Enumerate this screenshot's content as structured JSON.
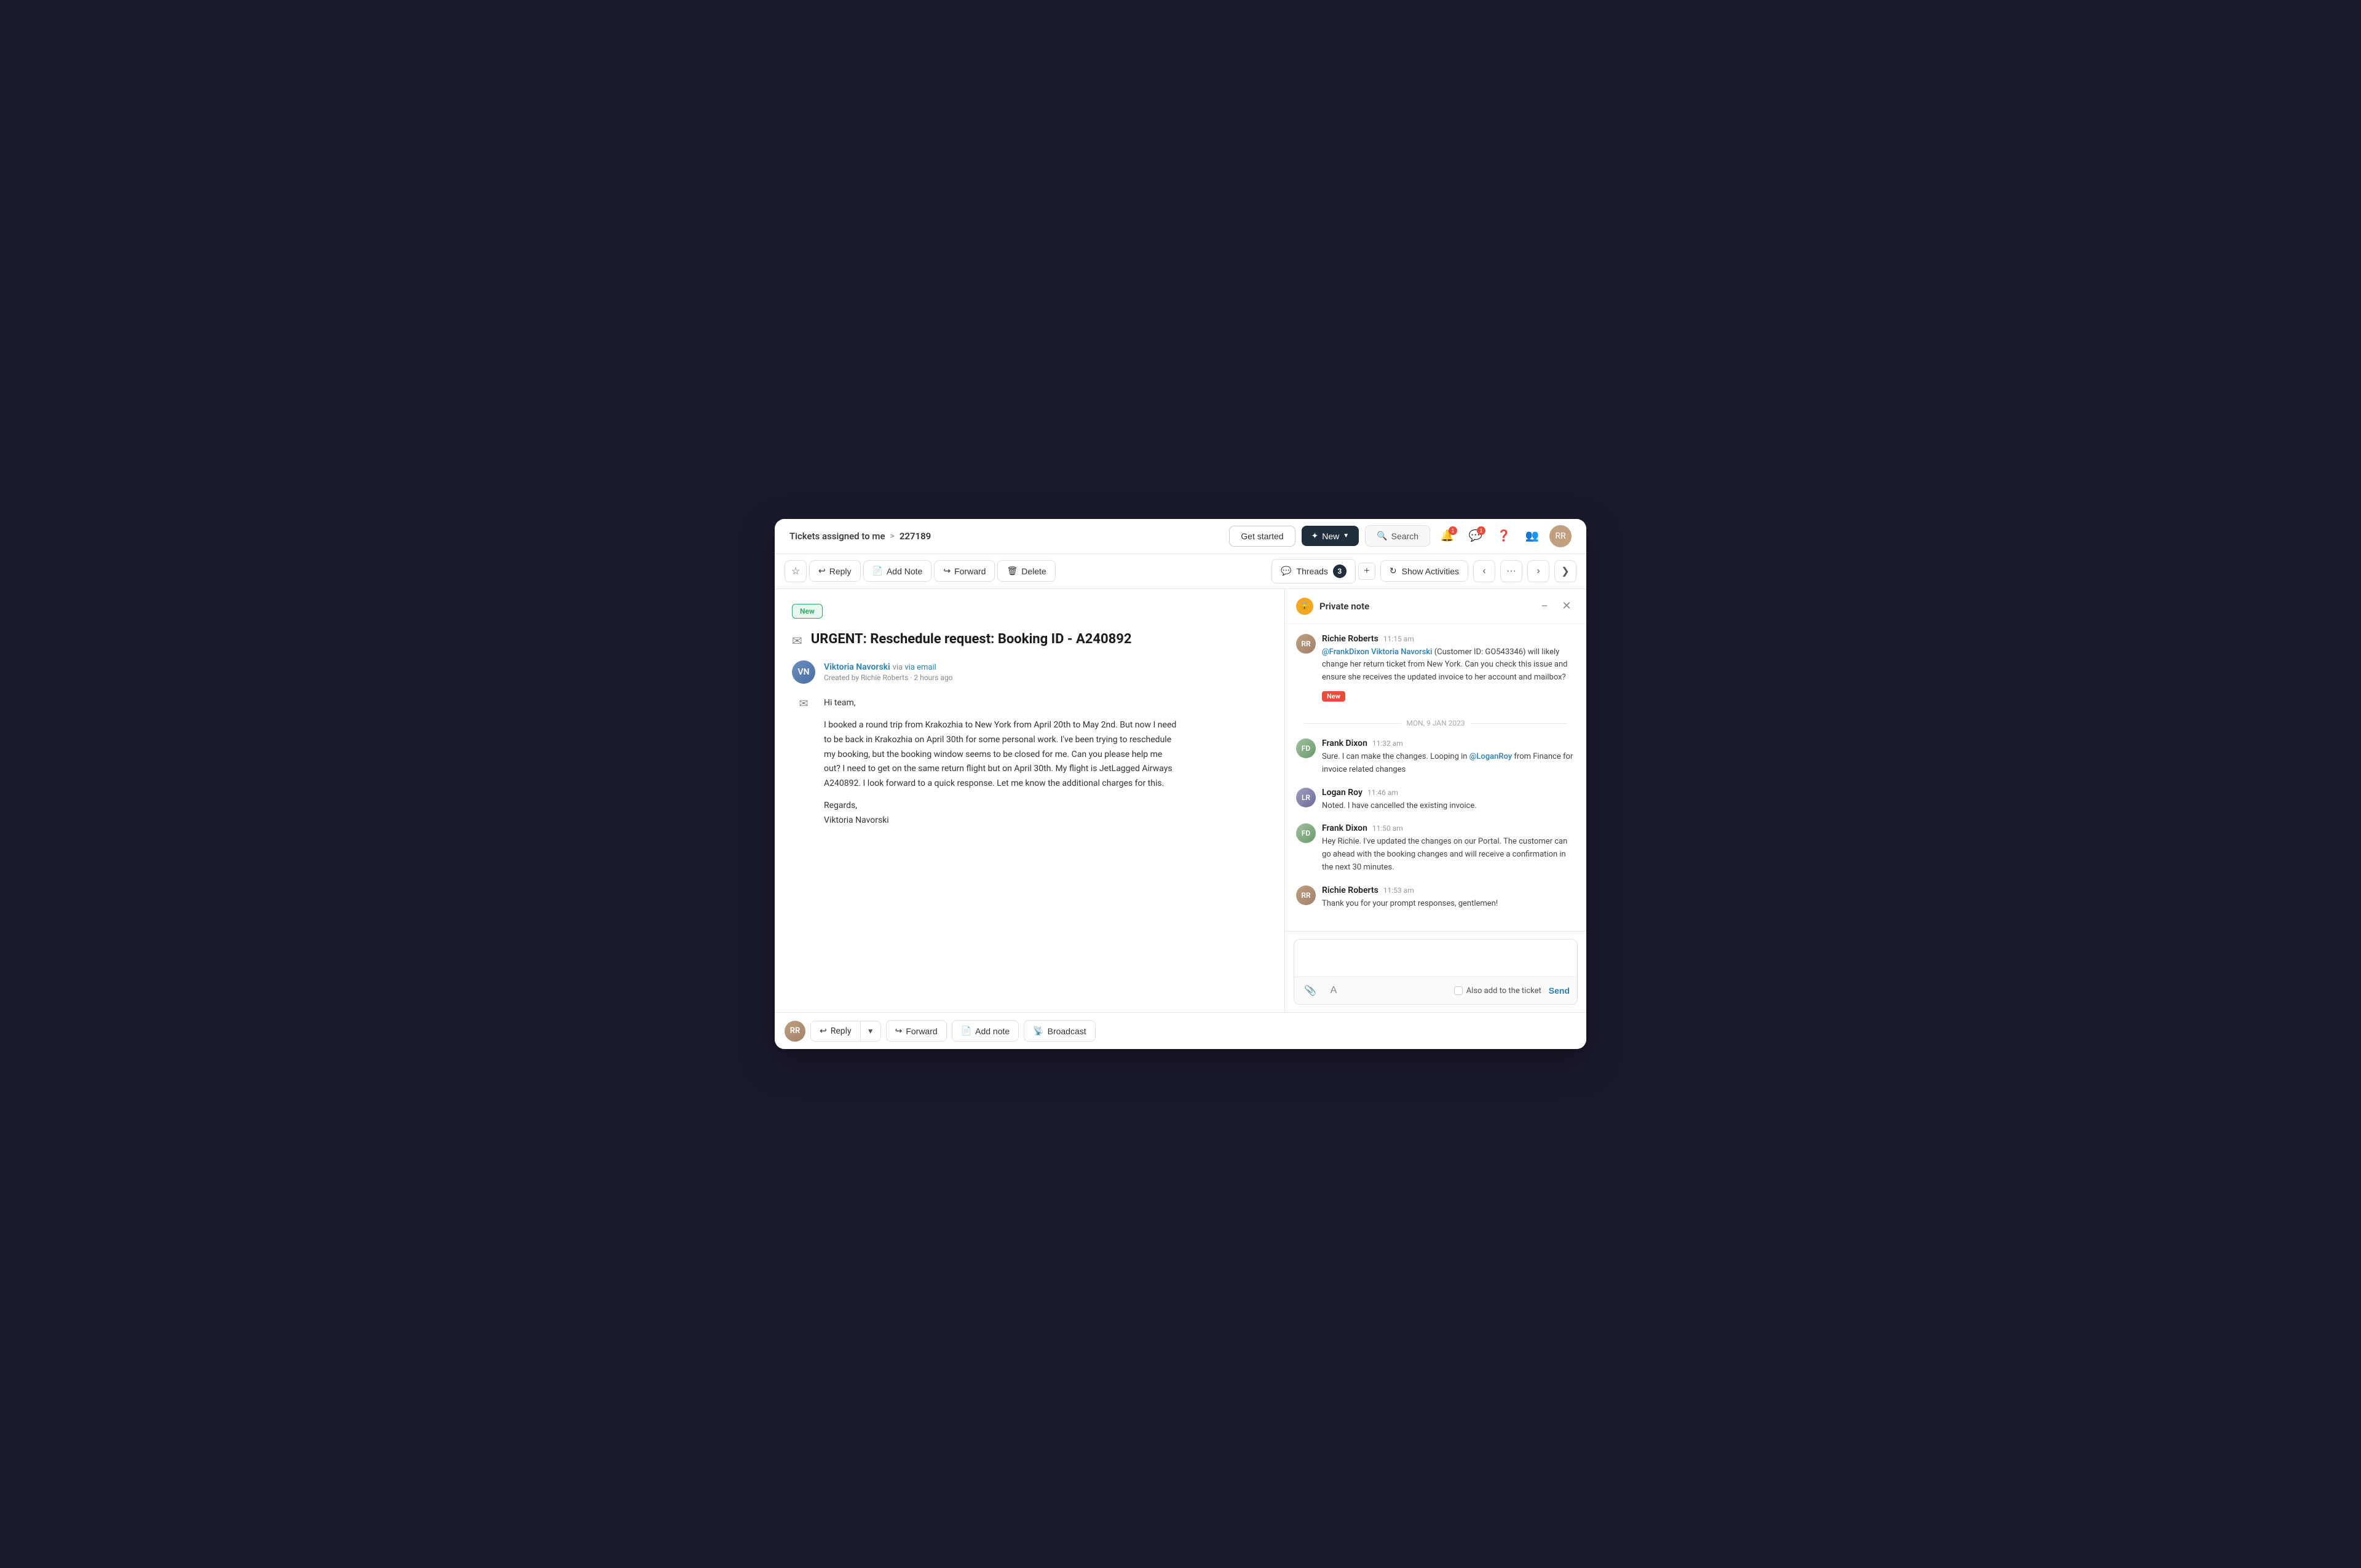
{
  "nav": {
    "breadcrumb_base": "Tickets assigned to me",
    "breadcrumb_sep": ">",
    "breadcrumb_ticket": "227189",
    "get_started": "Get started",
    "new_btn": "New",
    "search_btn": "Search",
    "avatar_initials": "RR"
  },
  "toolbar": {
    "reply": "Reply",
    "add_note": "Add Note",
    "forward": "Forward",
    "delete": "Delete",
    "threads_label": "Threads",
    "threads_count": "3",
    "threads_add": "+",
    "show_activities": "Show Activities"
  },
  "email": {
    "new_badge": "New",
    "subject": "URGENT: Reschedule request: Booking ID - A240892",
    "sender_name": "Viktoria Navorski",
    "sender_via": "via email",
    "created_by": "Created by Richie Roberts · 2 hours ago",
    "greeting": "Hi team,",
    "body_line1": "I booked a round trip from Krakozhia to New York from April 20th to May 2nd. But now I need",
    "body_line2": "to be  back in Krakozhia on April 30th for some personal work. I've been trying to reschedule",
    "body_line3": "my booking,  but the booking window seems to be closed for me. Can you please help me",
    "body_line4": "out? I need to get on  the same return flight but on April 30th. My flight is JetLagged Airways",
    "body_line5": "A240892.   I look forward to a quick response. Let me know the additional charges for this.",
    "regards": "Regards,",
    "sign_name": "Viktoria Navorski"
  },
  "bottom_actions": {
    "reply": "Reply",
    "forward": "Forward",
    "add_note": "Add note",
    "broadcast": "Broadcast"
  },
  "right_panel": {
    "title": "Private note",
    "date_divider": "MON, 9 JAN 2023",
    "new_badge": "New",
    "messages": [
      {
        "id": "msg1",
        "sender": "Richie Roberts",
        "time": "11:15 am",
        "avatar_class": "richie",
        "avatar_initials": "RR",
        "text_prefix": "",
        "mention1": "@FrankDixon",
        "mention2": "Viktoria Navorski",
        "text_after": "(Customer ID: GO543346) will likely change her return ticket from New York. Can you check this issue and ensure she receives the updated invoice to her account and mailbox?",
        "has_new_badge": true
      },
      {
        "id": "msg2",
        "sender": "Frank Dixon",
        "time": "11:32 am",
        "avatar_class": "frank",
        "avatar_initials": "FD",
        "text_prefix": "Sure. I can make the changes. Looping in ",
        "mention": "@LoganRoy",
        "text_after": " from Finance for invoice related changes",
        "has_new_badge": false
      },
      {
        "id": "msg3",
        "sender": "Logan Roy",
        "time": "11:46 am",
        "avatar_class": "logan",
        "avatar_initials": "LR",
        "text": "Noted. I have cancelled the existing invoice.",
        "has_new_badge": false
      },
      {
        "id": "msg4",
        "sender": "Frank Dixon",
        "time": "11:50 am",
        "avatar_class": "frank",
        "avatar_initials": "FD",
        "text": "Hey Richie. I've updated the changes on our Portal. The customer can go ahead with the booking changes and will receive a confirmation in the next 30 minutes.",
        "has_new_badge": false
      },
      {
        "id": "msg5",
        "sender": "Richie Roberts",
        "time": "11:53 am",
        "avatar_class": "richie",
        "avatar_initials": "RR",
        "text": "Thank you for your prompt responses, gentlemen!",
        "has_new_badge": false
      }
    ],
    "reply_input_placeholder": "",
    "also_add_label": "Also add to the ticket",
    "send_btn": "Send"
  }
}
